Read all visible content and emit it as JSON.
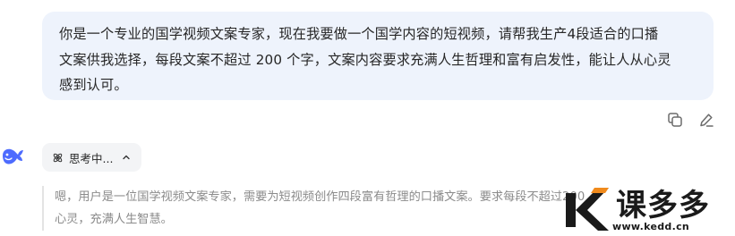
{
  "user_message": {
    "lines": [
      "你是一个专业的国学视频文案专家，现在我要做一个国学内容的短视频，请帮我生产4段适合的口播",
      "文案供我选择，每段文案不超过 200 个字，文案内容要求充满人生哲理和富有启发性，能让人从心灵",
      "感到认可。"
    ]
  },
  "message_actions": {
    "copy_icon": "copy-icon",
    "edit_icon": "edit-icon"
  },
  "assistant": {
    "avatar_icon": "whale-icon",
    "thinking_label": "思考中...",
    "thinking_lines": [
      "嗯，用户是一位国学视频文案专家，需要为短视频创作四段富有哲理的口播文案。要求每段不超过200",
      "心灵，充满人生智慧。"
    ]
  },
  "watermark": {
    "brand": "课多多",
    "url": "www.kedd.cn"
  },
  "colors": {
    "bubble_bg": "#eef3fc",
    "brand_blue": "#4d6bfe",
    "toggle_bg": "#f3f4f6",
    "thinking_text": "#8b8b8b"
  }
}
